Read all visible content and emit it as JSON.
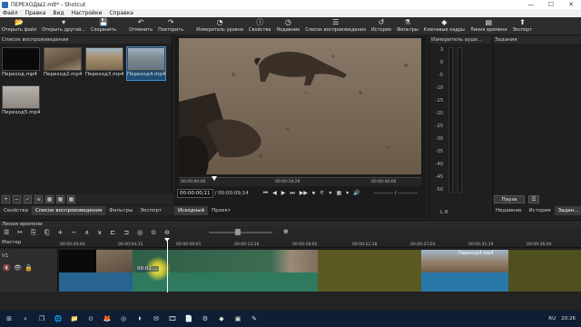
{
  "window": {
    "title": "ПЕРЕХОДЫ2.mlt* - Shotcut",
    "controls": [
      "—",
      "☐",
      "✕"
    ]
  },
  "menu": [
    "Файл",
    "Правка",
    "Вид",
    "Настройки",
    "Справка"
  ],
  "toolbar": [
    {
      "icon": "folder-open-icon",
      "glyph": "📂",
      "label": "Открыть файл"
    },
    {
      "icon": "folder-open-other-icon",
      "glyph": "▾",
      "label": "Открыть другой..."
    },
    {
      "icon": "save-icon",
      "glyph": "💾",
      "label": "Сохранить"
    },
    {
      "icon": "undo-icon",
      "glyph": "↶",
      "label": "Отменить"
    },
    {
      "icon": "redo-icon",
      "glyph": "↷",
      "label": "Повторить"
    },
    {
      "icon": "peak-meter-icon",
      "glyph": "◔",
      "label": "Измеритель уровня"
    },
    {
      "icon": "properties-icon",
      "glyph": "ⓘ",
      "label": "Свойства"
    },
    {
      "icon": "recent-icon",
      "glyph": "◷",
      "label": "Недавние"
    },
    {
      "icon": "playlist-icon",
      "glyph": "☰",
      "label": "Список воспроизведения"
    },
    {
      "icon": "history-icon",
      "glyph": "↺",
      "label": "История"
    },
    {
      "icon": "filters-icon",
      "glyph": "⚗",
      "label": "Фильтры"
    },
    {
      "icon": "keyframes-icon",
      "glyph": "◆",
      "label": "Ключевые кадры"
    },
    {
      "icon": "timeline-icon",
      "glyph": "▤",
      "label": "Линия времени"
    },
    {
      "icon": "export-icon",
      "glyph": "⬆",
      "label": "Экспорт"
    }
  ],
  "playlist": {
    "header": "Список воспроизведения",
    "items": [
      {
        "label": "Переход.mp4",
        "color": "#0a0a0a",
        "selected": false
      },
      {
        "label": "Переход2.mp4",
        "color": "#7a6a58",
        "selected": false
      },
      {
        "label": "Переход3.mp4",
        "color": "#8e7c62",
        "selected": false
      },
      {
        "label": "Переход4.mp4",
        "color": "#6d7c8a",
        "selected": true
      },
      {
        "label": "Переход5.mp4",
        "color": "#a6a09a",
        "selected": false
      }
    ],
    "tools": [
      "+",
      "−",
      "✓",
      "≡",
      "▦",
      "▦",
      "▦"
    ],
    "tabs": [
      "Свойства",
      "Список воспроизведения",
      "Фильтры",
      "Экспорт"
    ],
    "active_tab": 1
  },
  "player": {
    "ruler_ticks": [
      "00:00:00;00",
      "00:00:19;29",
      "00:00:40;00"
    ],
    "current_time": "00:00:00;11",
    "total_time": "/ 00:00:09;14",
    "controls": [
      "⏮",
      "◀",
      "▶",
      "⏭",
      "▶▶",
      "⏹",
      "⚟",
      "▾",
      "▦",
      "▾",
      "🔊"
    ],
    "in_out": "--:--:--:-- / --:--:--:--",
    "tabs": [
      "Исходный",
      "Проект"
    ],
    "active_tab": 0
  },
  "meter": {
    "header": "Измеритель ауди...",
    "scale": [
      "3",
      "0",
      "-5",
      "-10",
      "-15",
      "-20",
      "-25",
      "-30",
      "-35",
      "-40",
      "-45",
      "-50"
    ],
    "channels": "L  R"
  },
  "jobs": {
    "header": "Задания",
    "pause": "Пауза",
    "menu": "☰",
    "tabs": [
      "Недавние",
      "История",
      "Задан..."
    ],
    "active_tab": 2
  },
  "timeline": {
    "header": "Линия времени",
    "tools": [
      "☰",
      "✂",
      "⎘",
      "⎗",
      "+",
      "−",
      "∧",
      "∨",
      "⊏",
      "⊐",
      "◎",
      "⊙",
      "⊖",
      "⊕"
    ],
    "master_label": "Мастер",
    "ticks": [
      "00:00:00;00",
      "00:00:04;15",
      "00:00:09;01",
      "00:00:13;16",
      "00:00:18;02",
      "00:00:22;18",
      "00:00:27;03",
      "00:00:31;19",
      "00:00:36;04"
    ],
    "track": {
      "name": "V1",
      "icons": [
        "🔇",
        "👁",
        "🔒"
      ]
    },
    "clip_label": "Переход4.mp4",
    "drag_label": "00:02:...",
    "zoom": 0.45
  },
  "taskbar": {
    "apps": [
      "⊞",
      "⌕",
      "❒",
      "🌐",
      "📁",
      "⊙",
      "🦊",
      "◎",
      "⏵",
      "✉",
      "🎞",
      "📄",
      "⚙",
      "◆",
      "▣",
      "✎"
    ],
    "lang": "RU",
    "time": "20:26"
  }
}
